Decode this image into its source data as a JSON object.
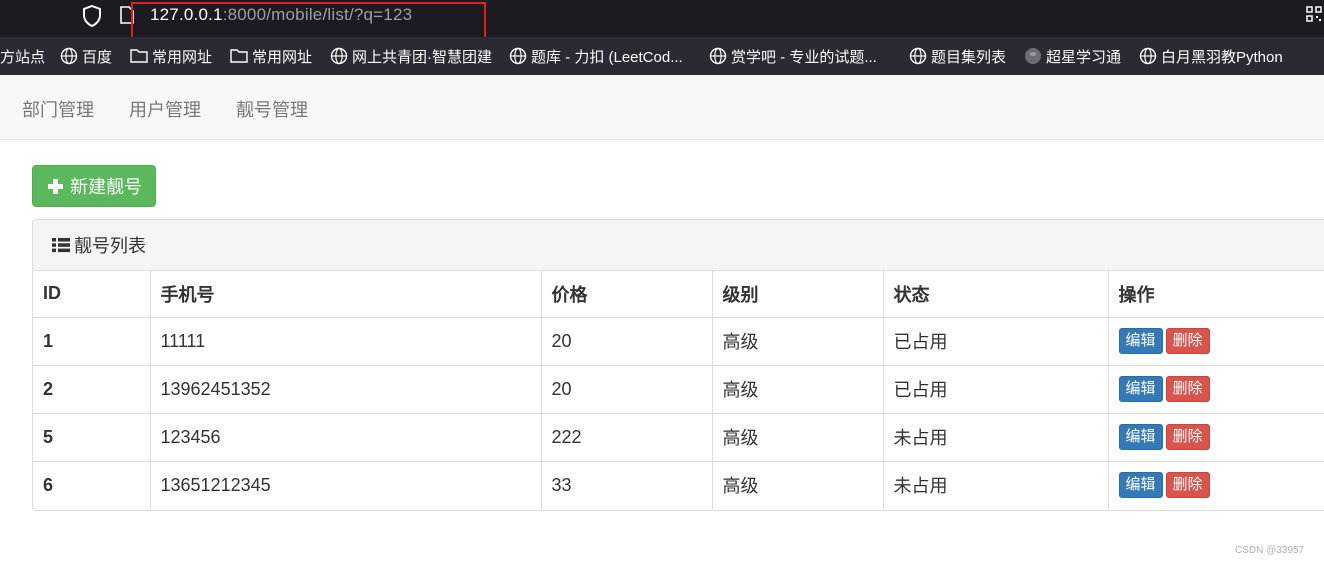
{
  "browser": {
    "url_host": "127.0.0.1",
    "url_rest": ":8000/mobile/list/?q=123",
    "bookmarks": [
      {
        "label": "方站点",
        "icon": "none"
      },
      {
        "label": "百度",
        "icon": "globe-icon"
      },
      {
        "label": "常用网址",
        "icon": "folder-icon"
      },
      {
        "label": "常用网址",
        "icon": "folder-icon"
      },
      {
        "label": "网上共青团·智慧团建",
        "icon": "globe-icon"
      },
      {
        "label": "题库 - 力扣 (LeetCod...",
        "icon": "globe-icon"
      },
      {
        "label": "赏学吧 - 专业的试题...",
        "icon": "globe-icon"
      },
      {
        "label": "题目集列表",
        "icon": "globe-icon"
      },
      {
        "label": "超星学习通",
        "icon": "favicon-icon"
      },
      {
        "label": "白月黑羽教Python",
        "icon": "globe-icon"
      }
    ]
  },
  "nav": {
    "items": [
      "部门管理",
      "用户管理",
      "靓号管理"
    ]
  },
  "actions": {
    "new_label": "新建靓号"
  },
  "panel": {
    "title": "靓号列表"
  },
  "table": {
    "headers": [
      "ID",
      "手机号",
      "价格",
      "级别",
      "状态",
      "操作"
    ],
    "rows": [
      {
        "id": "1",
        "phone": "11111",
        "price": "20",
        "level": "高级",
        "status": "已占用"
      },
      {
        "id": "2",
        "phone": "13962451352",
        "price": "20",
        "level": "高级",
        "status": "已占用"
      },
      {
        "id": "5",
        "phone": "123456",
        "price": "222",
        "level": "高级",
        "status": "未占用"
      },
      {
        "id": "6",
        "phone": "13651212345",
        "price": "33",
        "level": "高级",
        "status": "未占用"
      }
    ],
    "edit_label": "编辑",
    "delete_label": "删除"
  },
  "watermark": "CSDN @33957",
  "colors": {
    "success": "#5cb85c",
    "primary": "#337ab7",
    "danger": "#d9534f",
    "highlight_box": "#e0201f"
  }
}
